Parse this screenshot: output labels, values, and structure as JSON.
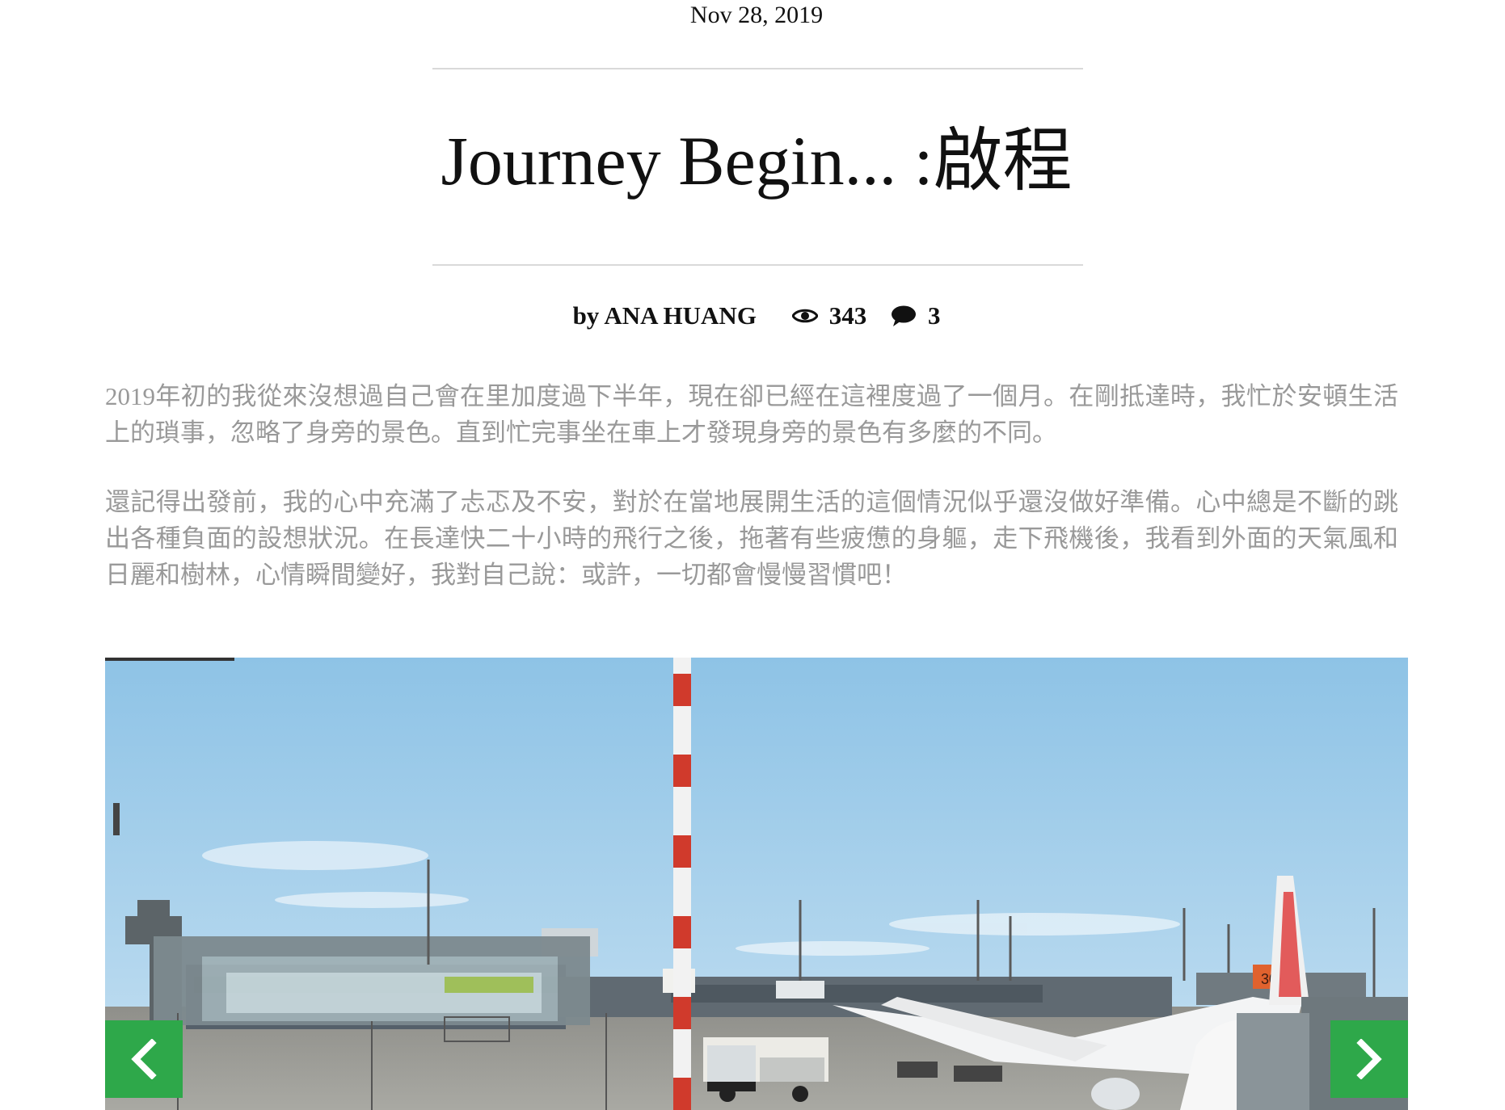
{
  "post": {
    "date": "Nov 28, 2019",
    "title": "Journey Begin... :啟程",
    "author": "by ANA HUANG",
    "views": "343",
    "comments": "3"
  },
  "content": {
    "paragraphs": [
      "2019年初的我從來沒想過自己會在里加度過下半年，現在卻已經在這裡度過了一個月。在剛抵達時，我忙於安頓生活上的瑣事，忽略了身旁的景色。直到忙完事坐在車上才發現身旁的景色有多麼的不同。",
      "還記得出發前，我的心中充滿了忐忑及不安，對於在當地展開生活的這個情況似乎還沒做好準備。心中總是不斷的跳出各種負面的設想狀況。在長達快二十小時的飛行之後，拖著有些疲憊的身軀，走下飛機後，我看到外面的天氣風和日麗和樹林，心情瞬間變好，我對自己說：或許，一切都會慢慢習慣吧！"
    ]
  },
  "slider": {
    "photo_icon": "airport-apron-photo",
    "gate_sign": "307",
    "prev_icon": "chevron-left-icon",
    "next_icon": "chevron-right-icon",
    "accent_color": "#2ea84a"
  },
  "colors": {
    "text": "#111111",
    "muted_text": "#999999",
    "rule": "#d9d9d9"
  }
}
